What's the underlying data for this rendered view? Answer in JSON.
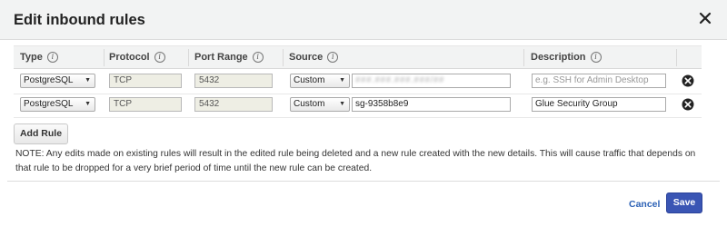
{
  "dialog": {
    "title": "Edit inbound rules"
  },
  "columns": [
    {
      "label": "Type"
    },
    {
      "label": "Protocol"
    },
    {
      "label": "Port Range"
    },
    {
      "label": "Source"
    },
    {
      "label": "Description"
    }
  ],
  "info_glyph": "i",
  "rules": [
    {
      "type": "PostgreSQL",
      "protocol": "TCP",
      "port_range": "5432",
      "source_mode": "Custom",
      "source_value": "###.###.###.###/##",
      "description": "",
      "description_placeholder": "e.g. SSH for Admin Desktop"
    },
    {
      "type": "PostgreSQL",
      "protocol": "TCP",
      "port_range": "5432",
      "source_mode": "Custom",
      "source_value": "sg-9358b8e9",
      "description": "Glue Security Group",
      "description_placeholder": ""
    }
  ],
  "actions": {
    "add_rule": "Add Rule",
    "cancel": "Cancel",
    "save": "Save"
  },
  "note": "NOTE: Any edits made on existing rules will result in the edited rule being deleted and a new rule created with the new details. This will cause traffic that depends on that rule to be dropped for a very brief period of time until the new rule can be created.",
  "icons": {
    "close": "close-icon",
    "delete": "remove-circle-icon",
    "dropdown": "chevron-down-icon",
    "info": "info-circle-icon"
  },
  "colors": {
    "header_bg": "#f2f3f3",
    "primary_button": "#3a55b4",
    "link": "#2d62b6",
    "readonly_field": "#eeeee4"
  }
}
